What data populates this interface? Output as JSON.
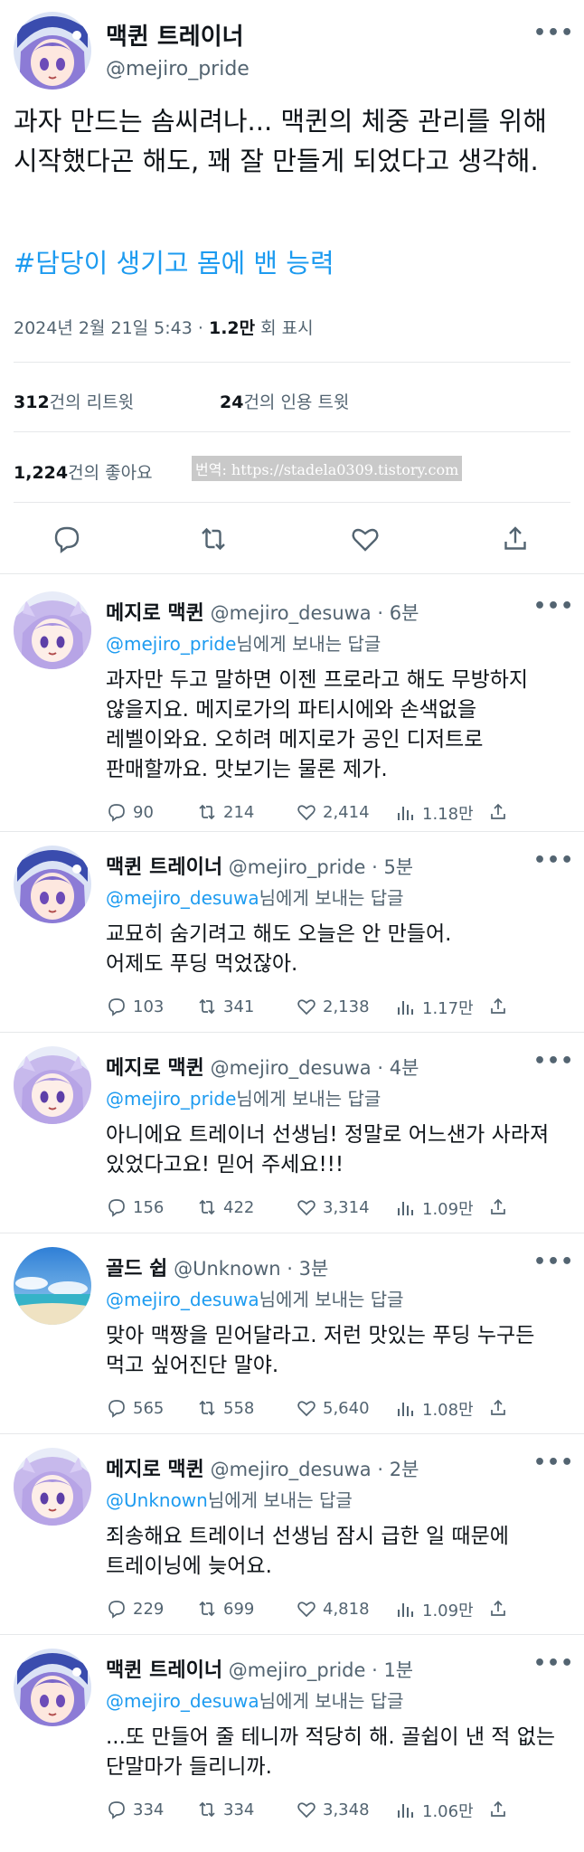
{
  "main": {
    "display_name": "맥퀸 트레이너",
    "handle": "@mejiro_pride",
    "more": "•••",
    "text": "과자 만드는 솜씨려나... 맥퀸의 체중 관리를 위해 시작했다곤 해도, 꽤 잘 만들게 되었다고 생각해.",
    "hashtag": "#담당이 생기고 몸에 밴 능력",
    "timestamp": "2024년 2월 21일  5:43 · ",
    "views_count": "1.2만",
    "views_label": " 회 표시",
    "retweets_count": "312",
    "retweets_label": "건의 리트윗",
    "quotes_count": "24",
    "quotes_label": "건의 인용 트윗",
    "likes_count": "1,224",
    "likes_label": "건의 좋아요",
    "watermark": "번역: https://stadela0309.tistory.com",
    "actions": [
      "reply-icon",
      "retweet-icon",
      "like-icon",
      "share-icon"
    ]
  },
  "reply_prefix_suffix": "님에게 보내는 답글",
  "replies": [
    {
      "name": "메지로 맥퀸",
      "handle": "@mejiro_desuwa",
      "time": " · 6분",
      "to": "@mejiro_pride",
      "avatar": "mcqueen",
      "text": "과자만 두고 말하면 이젠 프로라고 해도 무방하지 않을지요. 메지로가의 파티시에와 손색없을 레벨이와요. 오히려 메지로가 공인 디저트로 판매할까요. 맛보기는 물론 제가.",
      "replies": "90",
      "retweets": "214",
      "likes": "2,414",
      "views": "1.18만"
    },
    {
      "name": "맥퀸 트레이너",
      "handle": "@mejiro_pride",
      "time": " · 5분",
      "to": "@mejiro_desuwa",
      "avatar": "trainer",
      "text": "교묘히 숨기려고 해도 오늘은 안 만들어.\n어제도 푸딩 먹었잖아.",
      "replies": "103",
      "retweets": "341",
      "likes": "2,138",
      "views": "1.17만"
    },
    {
      "name": "메지로 맥퀸",
      "handle": "@mejiro_desuwa",
      "time": " · 4분",
      "to": "@mejiro_pride",
      "avatar": "mcqueen",
      "text": "아니에요 트레이너 선생님! 정말로 어느샌가 사라져 있었다고요! 믿어 주세요!!!",
      "replies": "156",
      "retweets": "422",
      "likes": "3,314",
      "views": "1.09만"
    },
    {
      "name": "골드 쉽",
      "handle": "@Unknown",
      "time": " · 3분",
      "to": "@mejiro_desuwa",
      "avatar": "beach",
      "text": "맞아 맥짱을 믿어달라고. 저런 맛있는 푸딩 누구든 먹고 싶어진단 말야.",
      "replies": "565",
      "retweets": "558",
      "likes": "5,640",
      "views": "1.08만"
    },
    {
      "name": "메지로 맥퀸",
      "handle": "@mejiro_desuwa",
      "time": " · 2분",
      "to": "@Unknown",
      "avatar": "mcqueen",
      "text": "죄송해요 트레이너 선생님 잠시 급한 일 때문에 트레이닝에 늦어요.",
      "replies": "229",
      "retweets": "699",
      "likes": "4,818",
      "views": "1.09만"
    },
    {
      "name": "맥퀸 트레이너",
      "handle": "@mejiro_pride",
      "time": " · 1분",
      "to": "@mejiro_desuwa",
      "avatar": "trainer",
      "text": "...또 만들어 줄 테니까 적당히 해. 골쉽이 낸 적 없는 단말마가 들리니까.",
      "replies": "334",
      "retweets": "334",
      "likes": "3,348",
      "views": "1.06만"
    }
  ],
  "colors": {
    "link": "#1d9bf0",
    "muted": "#536471",
    "text": "#0f1419",
    "divider": "#e6e8ea"
  }
}
